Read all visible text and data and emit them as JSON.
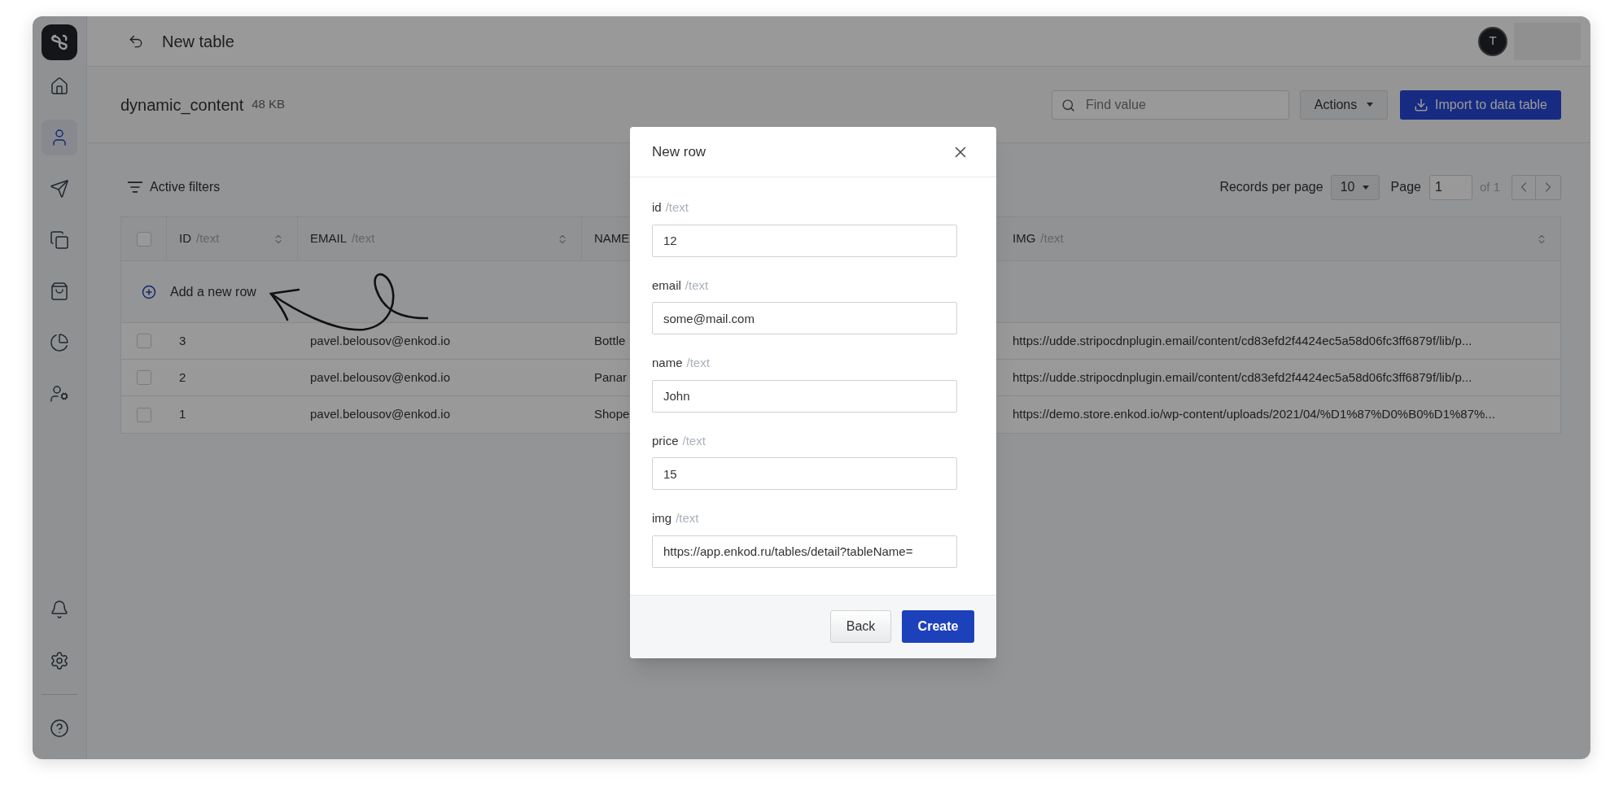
{
  "sidebar": {
    "items": [
      {
        "selected": false
      },
      {
        "selected": true
      },
      {
        "selected": false
      },
      {
        "selected": false
      },
      {
        "selected": false
      },
      {
        "selected": false
      },
      {
        "selected": false
      }
    ],
    "bottom_items": [
      {
        "selected": false
      },
      {
        "selected": false
      },
      {
        "selected": false
      }
    ]
  },
  "header": {
    "title": "New table",
    "avatar": "T"
  },
  "table_info": {
    "name": "dynamic_content",
    "size": "48 KB",
    "search": {
      "placeholder": "Find value"
    },
    "actions_button": "Actions",
    "import_button": "Import to data table"
  },
  "filters": {
    "label": "Active filters"
  },
  "pagination": {
    "records_label": "Records per page",
    "records_value": "10",
    "page_label": "Page",
    "page_value": "1",
    "page_total": "of 1"
  },
  "table": {
    "select_all_checked": false,
    "columns": [
      {
        "label": "ID",
        "type": "/text",
        "sortable": true
      },
      {
        "label": "EMAIL",
        "type": "/text",
        "sortable": true
      },
      {
        "label": "NAME"
      },
      {
        "label": "IMG",
        "type": "/text",
        "sortable": true
      }
    ],
    "add_row": "Add a new row",
    "rows": [
      {
        "checked": false,
        "cells": [
          "3",
          "pavel.belousov@enkod.io",
          "Bottle",
          "https://udde.stripocdnplugin.email/content/cd83efd2f4424ec5a58d06fc3ff6879f/lib/p..."
        ]
      },
      {
        "checked": false,
        "cells": [
          "2",
          "pavel.belousov@enkod.io",
          "Panar",
          "https://udde.stripocdnplugin.email/content/cd83efd2f4424ec5a58d06fc3ff6879f/lib/p..."
        ]
      },
      {
        "checked": false,
        "cells": [
          "1",
          "pavel.belousov@enkod.io",
          "Shope",
          "https://demo.store.enkod.io/wp-content/uploads/2021/04/%D1%87%D0%B0%D1%87%..."
        ]
      }
    ]
  },
  "modal": {
    "title": "New row",
    "fields": [
      {
        "label": "id",
        "type": "/text",
        "value": "12"
      },
      {
        "label": "email",
        "type": "/text",
        "value": "some@mail.com"
      },
      {
        "label": "name",
        "type": "/text",
        "value": "John"
      },
      {
        "label": "price",
        "type": "/text",
        "value": "15"
      },
      {
        "label": "img",
        "type": "/text",
        "value": "https://app.enkod.ru/tables/detail?tableName="
      }
    ],
    "back_button": "Back",
    "create_button": "Create"
  }
}
